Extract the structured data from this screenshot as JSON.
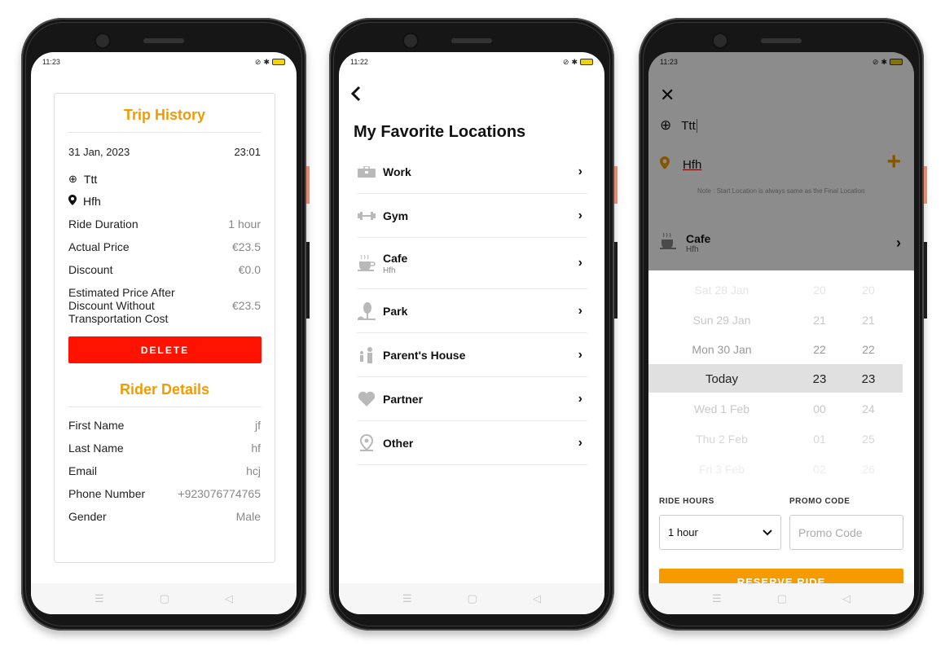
{
  "screen1": {
    "status_time": "11:23",
    "trip_history_title": "Trip History",
    "date": "31 Jan, 2023",
    "time": "23:01",
    "start_location": "Ttt",
    "end_location": "Hfh",
    "ride_duration_label": "Ride Duration",
    "ride_duration_value": "1 hour",
    "actual_price_label": "Actual Price",
    "actual_price_value": "€23.5",
    "discount_label": "Discount",
    "discount_value": "€0.0",
    "estimated_label": "Estimated Price After Discount Without Transportation Cost",
    "estimated_value": "€23.5",
    "delete_label": "DELETE",
    "rider_details_title": "Rider Details",
    "first_name_label": "First Name",
    "first_name_value": "jf",
    "last_name_label": "Last Name",
    "last_name_value": "hf",
    "email_label": "Email",
    "email_value": "hcj",
    "phone_label": "Phone Number",
    "phone_value": "+923076774765",
    "gender_label": "Gender",
    "gender_value": "Male"
  },
  "screen2": {
    "status_time": "11:22",
    "title": "My Favorite Locations",
    "items": [
      {
        "name": "Work",
        "sub": "",
        "icon": "briefcase-icon"
      },
      {
        "name": "Gym",
        "sub": "",
        "icon": "dumbbell-icon"
      },
      {
        "name": "Cafe",
        "sub": "Hfh",
        "icon": "coffee-icon"
      },
      {
        "name": "Park",
        "sub": "",
        "icon": "tree-icon"
      },
      {
        "name": "Parent's House",
        "sub": "",
        "icon": "family-icon"
      },
      {
        "name": "Partner",
        "sub": "",
        "icon": "heart-icon"
      },
      {
        "name": "Other",
        "sub": "",
        "icon": "location-pin-icon"
      }
    ]
  },
  "screen3": {
    "status_time": "11:23",
    "start_location": "Ttt",
    "final_location": "Hfh",
    "note": "Note : Start Location is always same as the Final Location",
    "fav_name": "Cafe",
    "fav_sub": "Hfh",
    "picker_rows": [
      {
        "day": "Sat 28 Jan",
        "h": "20",
        "m": "20"
      },
      {
        "day": "Sun 29 Jan",
        "h": "21",
        "m": "21"
      },
      {
        "day": "Mon 30 Jan",
        "h": "22",
        "m": "22"
      },
      {
        "day": "Today",
        "h": "23",
        "m": "23"
      },
      {
        "day": "Wed 1 Feb",
        "h": "00",
        "m": "24"
      },
      {
        "day": "Thu 2 Feb",
        "h": "01",
        "m": "25"
      },
      {
        "day": "Fri 3 Feb",
        "h": "02",
        "m": "26"
      }
    ],
    "ride_hours_label": "RIDE HOURS",
    "ride_hours_value": "1 hour",
    "promo_label": "PROMO CODE",
    "promo_placeholder": "Promo Code",
    "reserve_label": "RESERVE RIDE"
  },
  "colors": {
    "accent_orange": "#f29b00",
    "delete_red": "#ff1200",
    "reserve_orange": "#f59b00"
  }
}
